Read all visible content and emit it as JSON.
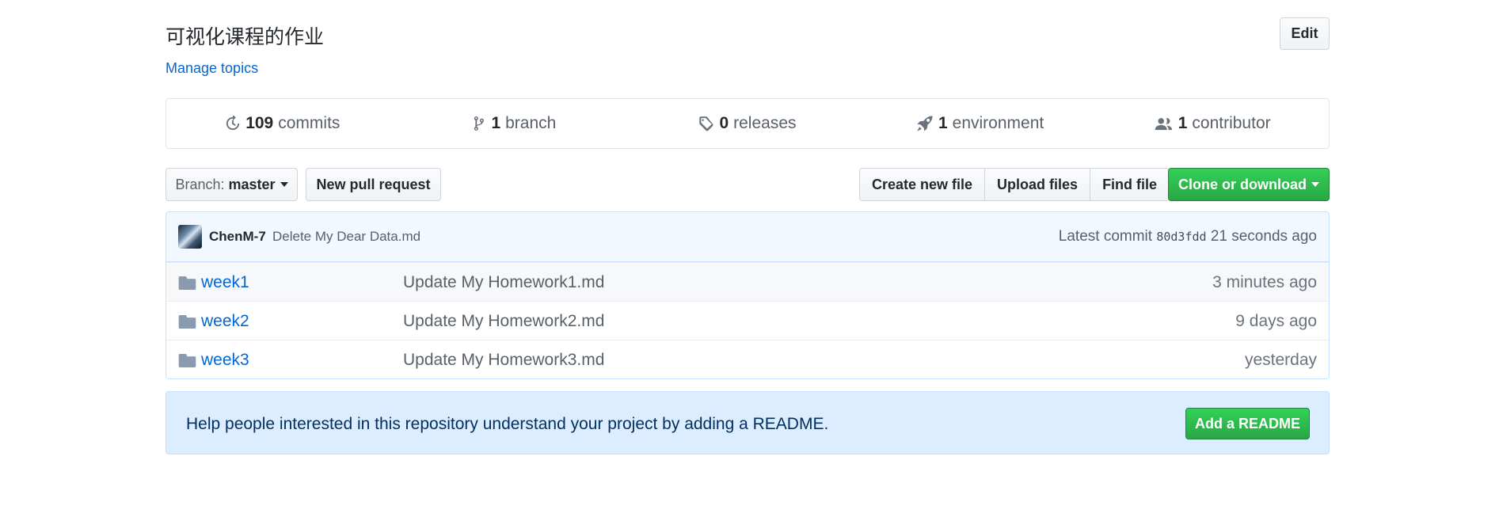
{
  "repo": {
    "description": "可视化课程的作业",
    "edit_label": "Edit",
    "manage_topics": "Manage topics"
  },
  "numbers": [
    {
      "icon": "history-icon",
      "count": "109",
      "label": "commits"
    },
    {
      "icon": "branch-icon",
      "count": "1",
      "label": "branch"
    },
    {
      "icon": "tag-icon",
      "count": "0",
      "label": "releases"
    },
    {
      "icon": "rocket-icon",
      "count": "1",
      "label": "environment"
    },
    {
      "icon": "people-icon",
      "count": "1",
      "label": "contributor"
    }
  ],
  "toolbar": {
    "branch_prefix": "Branch:",
    "branch_name": "master",
    "new_pr": "New pull request",
    "create_file": "Create new file",
    "upload_files": "Upload files",
    "find_file": "Find file",
    "clone": "Clone or download"
  },
  "commit": {
    "author": "ChenM-7",
    "message": "Delete My Dear Data.md",
    "latest_prefix": "Latest commit",
    "sha": "80d3fdd",
    "age": "21 seconds ago"
  },
  "files": [
    {
      "name": "week1",
      "message": "Update My Homework1.md",
      "age": "3 minutes ago"
    },
    {
      "name": "week2",
      "message": "Update My Homework2.md",
      "age": "9 days ago"
    },
    {
      "name": "week3",
      "message": "Update My Homework3.md",
      "age": "yesterday"
    }
  ],
  "readme": {
    "text": "Help people interested in this repository understand your project by adding a README.",
    "button": "Add a README"
  },
  "colors": {
    "link": "#0366d6",
    "primary_button": "#28a745",
    "readme_bg": "#dbedff"
  }
}
